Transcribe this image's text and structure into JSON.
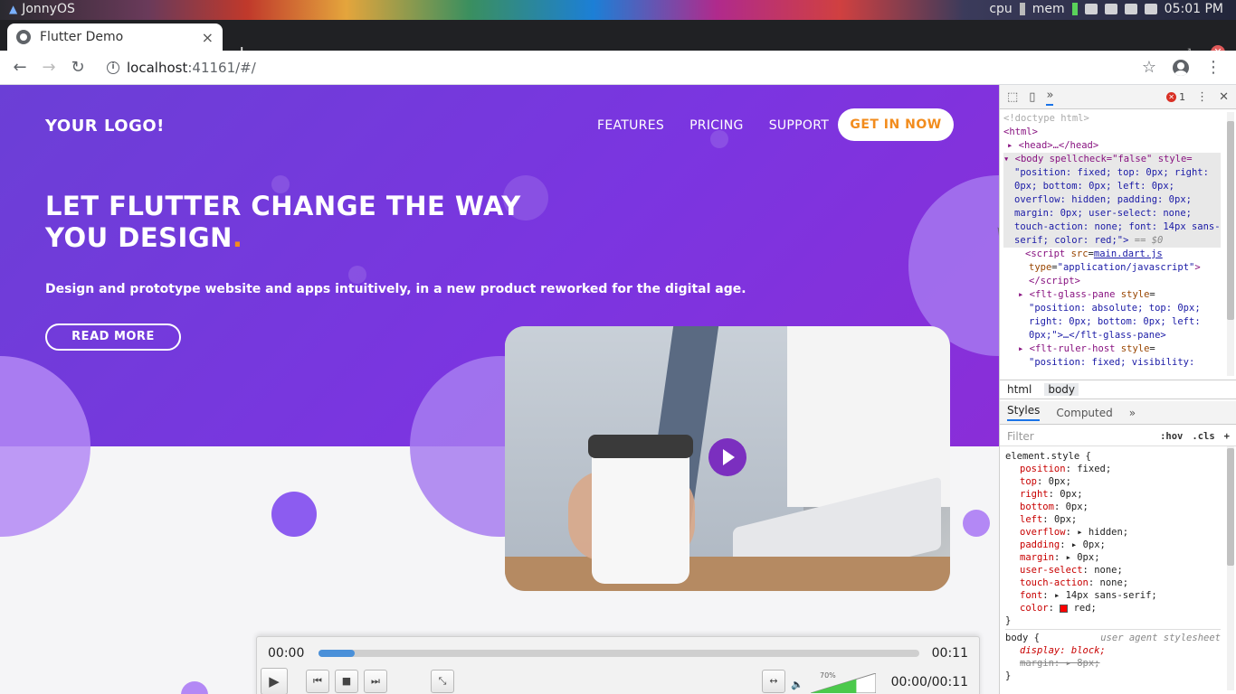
{
  "os": {
    "name": "JonnyOS",
    "cpu_label": "cpu",
    "mem_label": "mem",
    "clock": "05:01 PM"
  },
  "browser": {
    "tab_title": "Flutter Demo",
    "tab_close": "×",
    "new_tab": "+",
    "url_host": "localhost",
    "url_rest": ":41161/#/"
  },
  "site": {
    "logo": "YOUR LOGO!",
    "nav": [
      "FEATURES",
      "PRICING",
      "SUPPORT"
    ],
    "cta": "GET IN NOW",
    "headline_line1": "LET FLUTTER CHANGE THE WAY",
    "headline_line2": "YOU DESIGN",
    "headline_dot": ".",
    "subtitle": "Design and prototype website and apps intuitively, in a new product reworked for the digital age.",
    "read_more": "READ MORE",
    "colors": {
      "hero_start": "#6b3fd6",
      "hero_end": "#8a2ed8",
      "accent": "#f28c1d",
      "bubble": "#b388f5"
    }
  },
  "player": {
    "time_elapsed": "00:00",
    "time_total": "00:11",
    "progress": 0.06,
    "volume_label": "70%",
    "volume": 0.7,
    "position_readout": "00:00/00:11"
  },
  "devtools": {
    "error_count": "1",
    "dom": [
      "<!doctype html>",
      "<html>",
      "<head>…</head>"
    ],
    "body_line": "<body spellcheck=\"false\" style=",
    "body_style": "\"position: fixed; top: 0px; right: 0px; bottom: 0px; left: 0px; overflow: hidden; padding: 0px; margin: 0px; user-select: none; touch-action: none; font: 14px sans-serif; color: red;\">",
    "body_suffix": "== $0",
    "script_src": "main.dart.js",
    "script_type": "\"application/javascript\"",
    "breadcrumbs": [
      "html",
      "body"
    ],
    "style_tabs": [
      "Styles",
      "Computed"
    ],
    "filter_placeholder": "Filter",
    "hov": ":hov",
    "cls": ".cls",
    "element_style_selector": "element.style {",
    "props": [
      {
        "name": "position",
        "value": "fixed;"
      },
      {
        "name": "top",
        "value": "0px;"
      },
      {
        "name": "right",
        "value": "0px;"
      },
      {
        "name": "bottom",
        "value": "0px;"
      },
      {
        "name": "left",
        "value": "0px;"
      },
      {
        "name": "overflow",
        "value": "▸ hidden;"
      },
      {
        "name": "padding",
        "value": "▸ 0px;"
      },
      {
        "name": "margin",
        "value": "▸ 0px;"
      },
      {
        "name": "user-select",
        "value": "none;"
      },
      {
        "name": "touch-action",
        "value": "none;"
      },
      {
        "name": "font",
        "value": "▸ 14px sans-serif;"
      },
      {
        "name": "color",
        "value": "red;"
      }
    ],
    "ua_selector": "body {",
    "ua_label": "user agent stylesheet",
    "ua_display": "display: block;",
    "ua_margin": "margin: ▸ 8px;"
  }
}
